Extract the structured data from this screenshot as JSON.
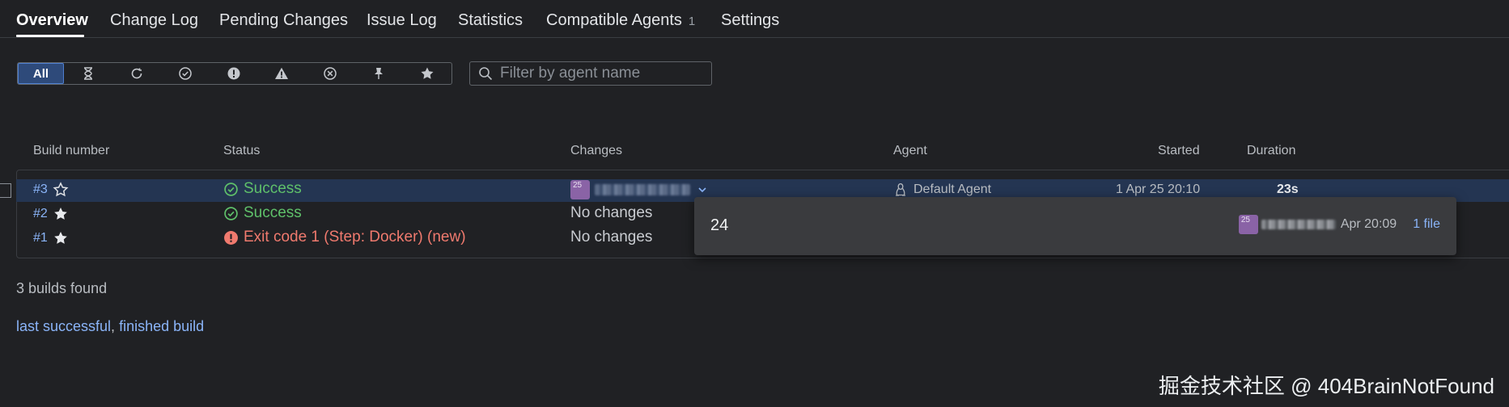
{
  "tabs": [
    {
      "label": "Overview",
      "active": true
    },
    {
      "label": "Change Log"
    },
    {
      "label": "Pending Changes"
    },
    {
      "label": "Issue Log"
    },
    {
      "label": "Statistics"
    },
    {
      "label": "Compatible Agents",
      "count": "1"
    },
    {
      "label": "Settings"
    }
  ],
  "filter": {
    "all_label": "All",
    "icons": [
      "hourglass-icon",
      "refresh-icon",
      "check-circle-icon",
      "exclamation-circle-icon",
      "warning-triangle-icon",
      "x-circle-icon",
      "pin-icon",
      "star-icon"
    ]
  },
  "search": {
    "placeholder": "Filter by agent name"
  },
  "table": {
    "headers": {
      "build": "Build number",
      "status": "Status",
      "changes": "Changes",
      "agent": "Agent",
      "started": "Started",
      "duration": "Duration"
    },
    "rows": [
      {
        "number": "#3",
        "starred": false,
        "status": "Success",
        "status_type": "success",
        "avatar": "25",
        "agent": "Default Agent",
        "started": "1 Apr 25 20:10",
        "duration": "23s"
      },
      {
        "number": "#2",
        "starred": true,
        "status": "Success",
        "status_type": "success",
        "changes": "No changes"
      },
      {
        "number": "#1",
        "starred": true,
        "status": "Exit code 1 (Step: Docker) (new)",
        "status_type": "error",
        "changes": "No changes"
      }
    ]
  },
  "popup": {
    "change_number": "24",
    "avatar": "25",
    "date": "Apr 20:09",
    "files": "1 file"
  },
  "footer": {
    "found": "3 builds found",
    "link_last_successful": "last successful",
    "separator": ",",
    "link_finished": "finished build"
  },
  "watermark": "掘金技术社区 @ 404BrainNotFound",
  "colors": {
    "background": "#202124",
    "accent": "#8ab4f8",
    "success": "#5fc06a",
    "error": "#f07a6e",
    "selected_row": "#243552",
    "avatar": "#8a63a6"
  }
}
